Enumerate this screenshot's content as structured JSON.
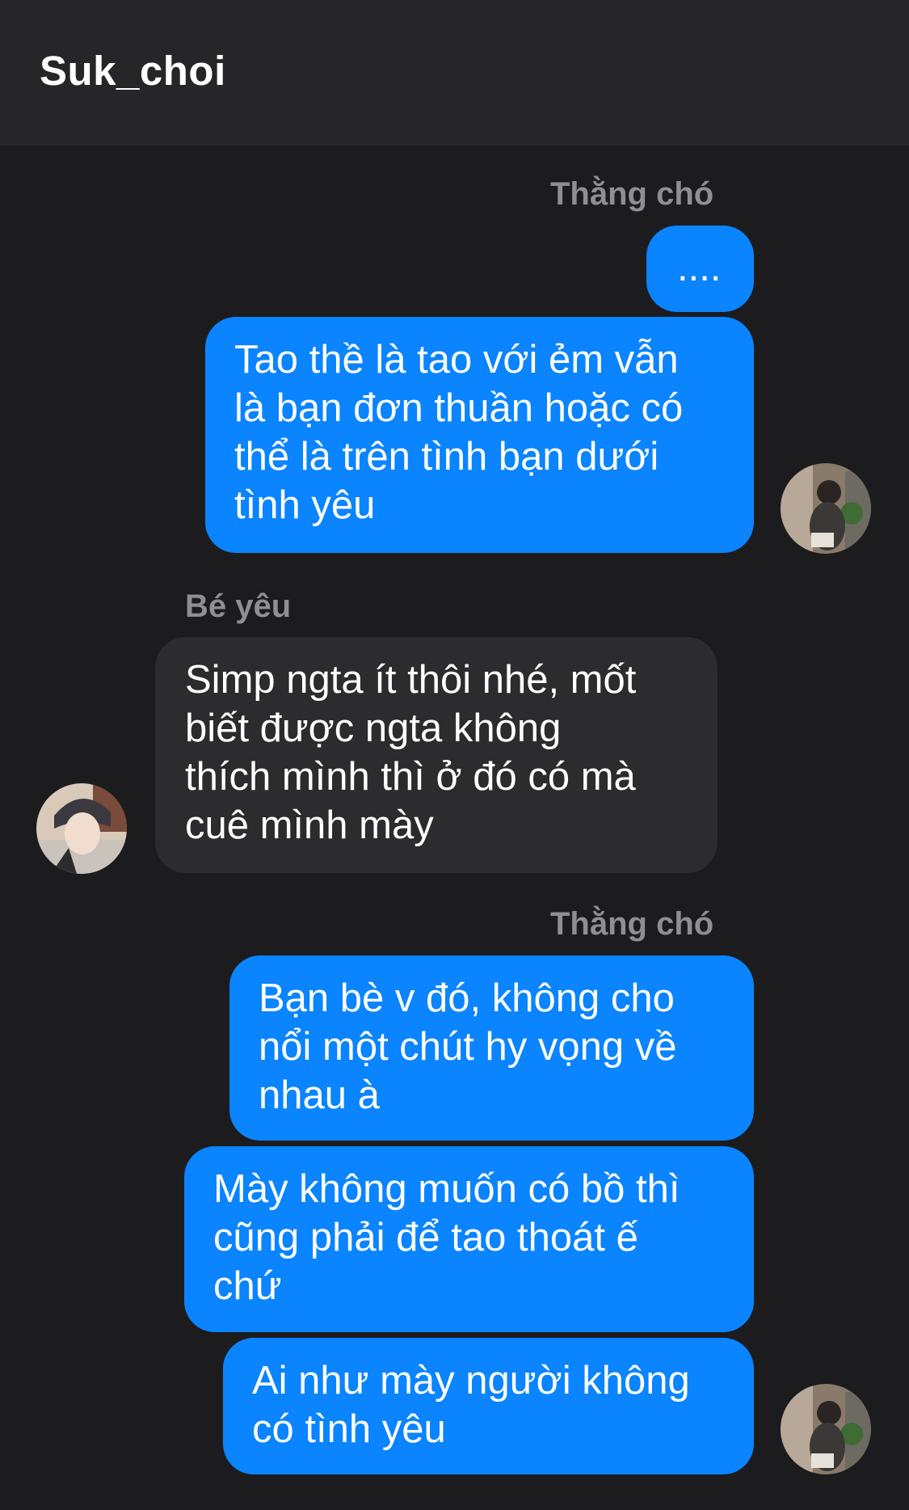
{
  "header": {
    "title": "Suk_choi"
  },
  "messages": [
    {
      "sender": "Thằng chó"
    },
    {
      "text": "...."
    },
    {
      "lines": [
        "Tao thề là tao với ẻm vẫn",
        "là bạn đơn thuần hoặc có",
        "thể là trên tình bạn dưới",
        "tình yêu"
      ]
    },
    {
      "sender": "Bé yêu"
    },
    {
      "lines": [
        "Simp ngta ít thôi nhé, mốt",
        "biết được ngta không",
        "thích mình thì ở đó có mà",
        "cuê mình mày"
      ]
    },
    {
      "sender": "Thằng chó"
    },
    {
      "lines": [
        "Bạn bè v đó, không cho",
        "nổi một chút hy vọng về",
        "nhau à"
      ]
    },
    {
      "lines": [
        "Mày không muốn có bồ thì",
        "cũng phải để tao thoát ế",
        "chứ"
      ]
    },
    {
      "lines": [
        "Ai như mày người không",
        "có tình yêu"
      ]
    }
  ],
  "colors": {
    "background": "#1c1c1e",
    "header": "#262628",
    "outgoing": "#0a84ff",
    "incoming": "#2c2c2e",
    "sender_label": "#8e8e93"
  },
  "icons": {
    "avatar_self": "avatar-photo",
    "avatar_other": "avatar-photo"
  }
}
